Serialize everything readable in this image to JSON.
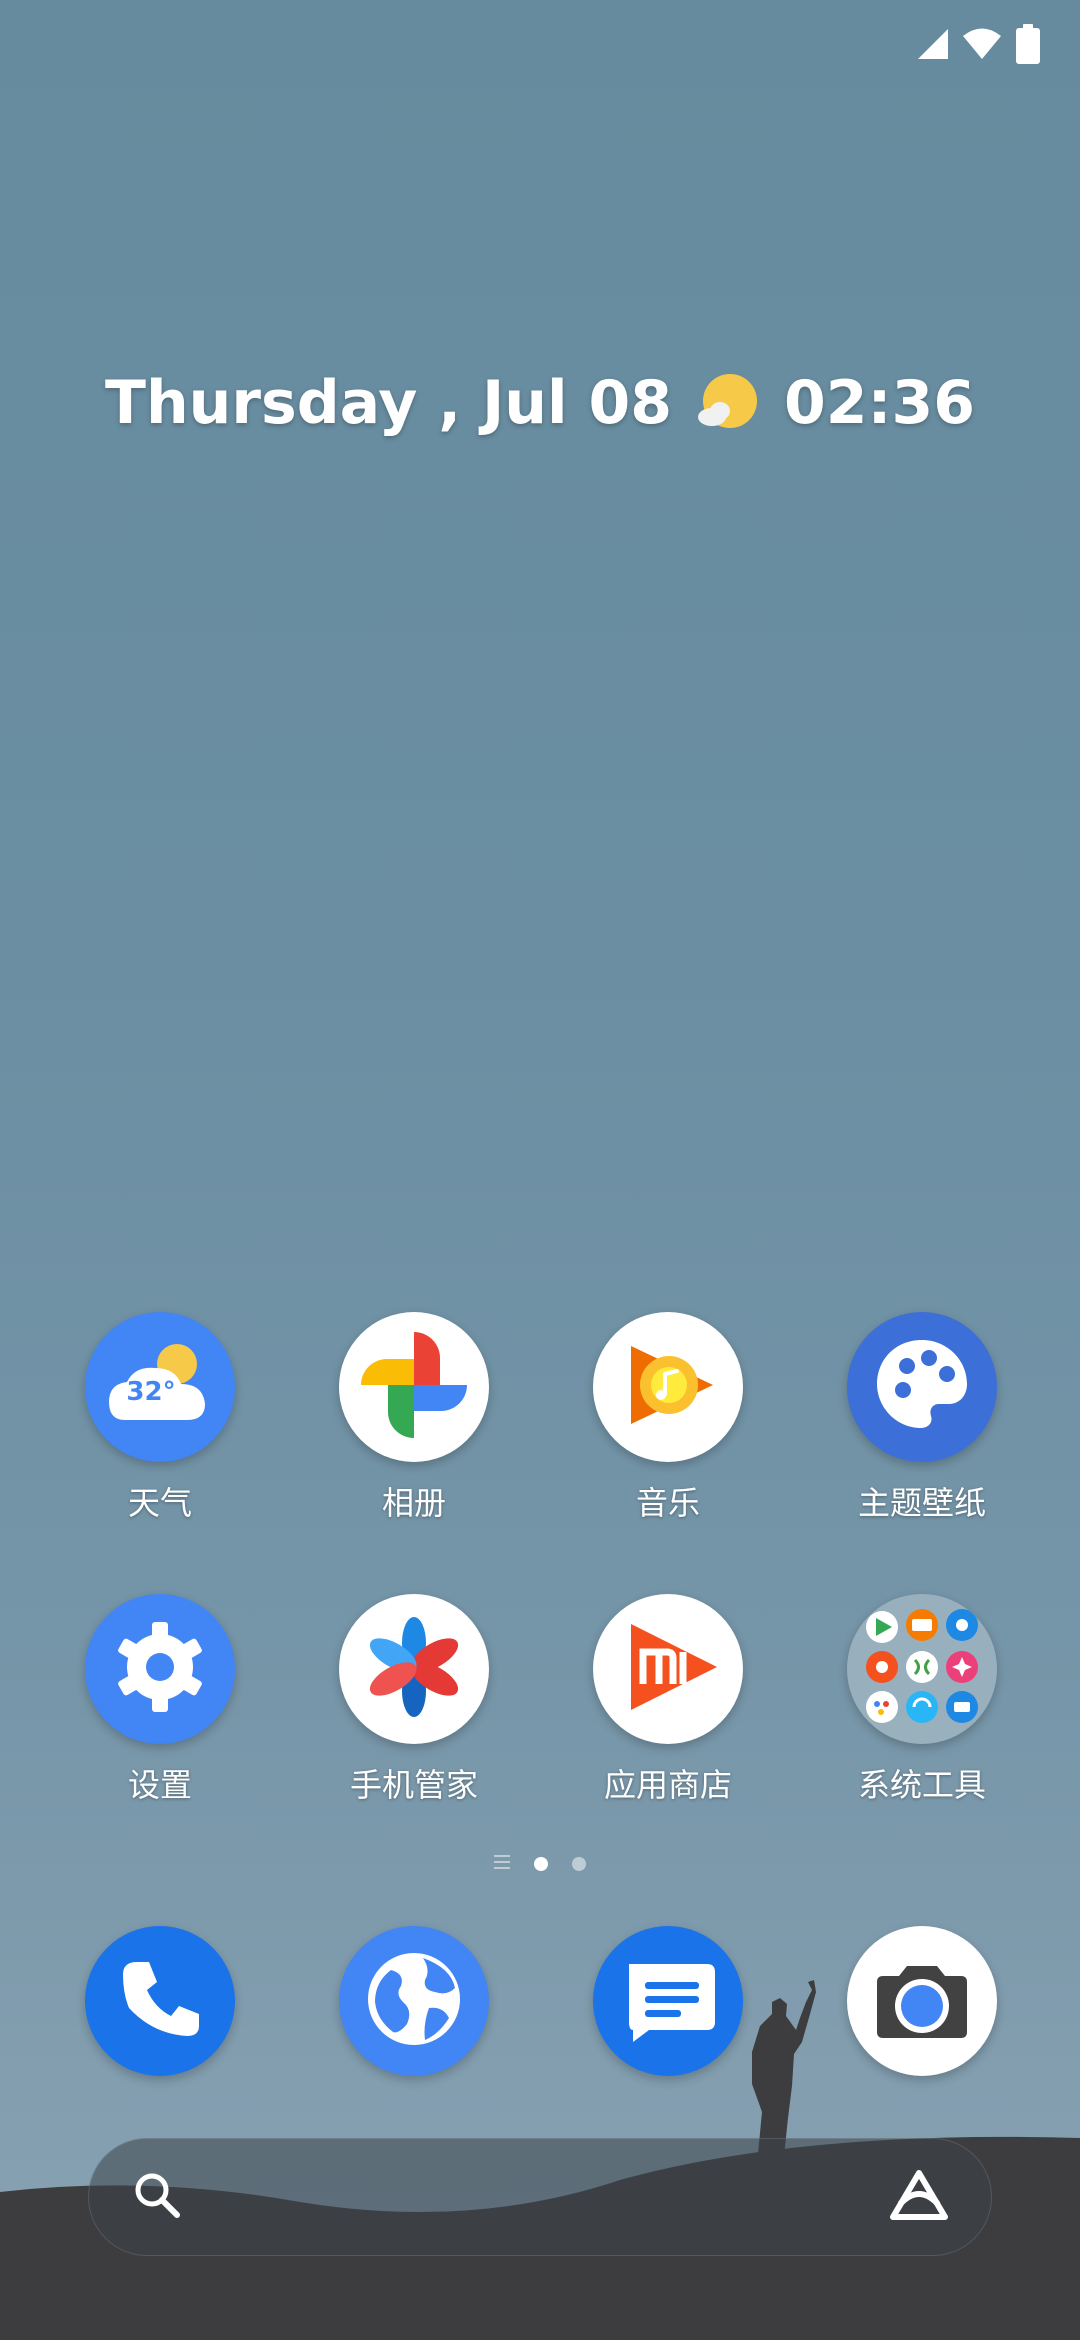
{
  "status_bar": {
    "icons": [
      "signal-icon",
      "wifi-icon",
      "battery-icon"
    ]
  },
  "widget": {
    "date": "Thursday , Jul 08",
    "time": "02:36",
    "weather_icon": "sun-cloud-icon"
  },
  "apps": [
    {
      "label": "天气",
      "icon": "weather-icon",
      "temp": "32°"
    },
    {
      "label": "相册",
      "icon": "photos-icon"
    },
    {
      "label": "音乐",
      "icon": "music-icon"
    },
    {
      "label": "主题壁纸",
      "icon": "palette-icon"
    },
    {
      "label": "设置",
      "icon": "gear-icon"
    },
    {
      "label": "手机管家",
      "icon": "security-icon"
    },
    {
      "label": "应用商店",
      "icon": "app-store-icon"
    },
    {
      "label": "系统工具",
      "icon": "folder-icon"
    }
  ],
  "pager": {
    "pages": 2,
    "current": 1
  },
  "dock": [
    {
      "icon": "phone-icon"
    },
    {
      "icon": "browser-icon"
    },
    {
      "icon": "messages-icon"
    },
    {
      "icon": "camera-icon"
    }
  ],
  "search": {
    "left_icon": "search-icon",
    "right_icon": "assistant-icon"
  },
  "colors": {
    "background": "#6b8ea2",
    "icon_blue": "#4285f4",
    "dock_blue": "#1a73e8",
    "hill": "#3d3d3f"
  }
}
